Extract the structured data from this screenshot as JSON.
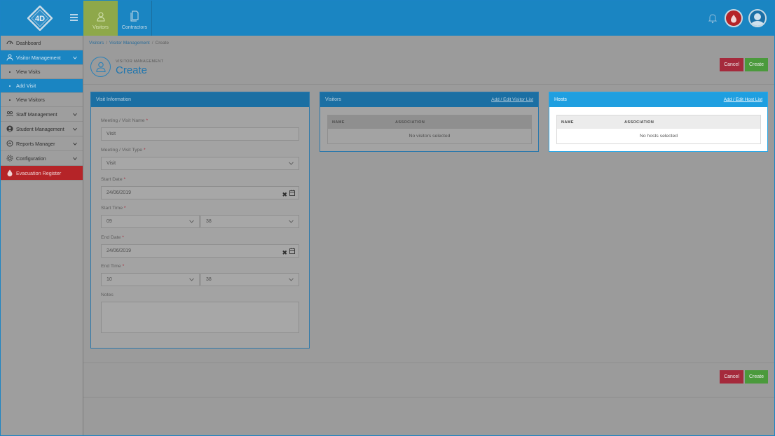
{
  "topbar": {
    "nav": [
      {
        "label": "Visitors"
      },
      {
        "label": "Contractors"
      }
    ]
  },
  "sidebar": {
    "items": [
      {
        "label": "Dashboard"
      },
      {
        "label": "Visitor Management"
      },
      {
        "label": "View Visits"
      },
      {
        "label": "Add Visit"
      },
      {
        "label": "View Visitors"
      },
      {
        "label": "Staff Management"
      },
      {
        "label": "Student Management"
      },
      {
        "label": "Reports Manager"
      },
      {
        "label": "Configuration"
      },
      {
        "label": "Evacuation Register"
      }
    ]
  },
  "breadcrumb": {
    "items": [
      "Visitors",
      "Visitor Management",
      "Create"
    ]
  },
  "page": {
    "subtitle": "VISITOR MANAGEMENT",
    "title": "Create"
  },
  "actions": {
    "cancel_label": "Cancel",
    "create_label": "Create"
  },
  "visit_info": {
    "heading": "Visit Information",
    "name_label": "Meeting / Visit Name",
    "name_value": "Visit",
    "type_label": "Meeting / Visit Type",
    "type_value": "Visit",
    "start_date_label": "Start Date",
    "start_date_value": "24/06/2019",
    "start_time_label": "Start Time",
    "start_hour": "09",
    "start_minute": "38",
    "end_date_label": "End Date",
    "end_date_value": "24/06/2019",
    "end_time_label": "End Time",
    "end_hour": "10",
    "end_minute": "38",
    "notes_label": "Notes",
    "required_mark": "*"
  },
  "visitors": {
    "heading": "Visitors",
    "link": "Add / Edit Visitor List",
    "col_name": "NAME",
    "col_association": "ASSOCIATION",
    "empty": "No visitors selected"
  },
  "hosts": {
    "heading": "Hosts",
    "link": "Add / Edit Host List",
    "col_name": "NAME",
    "col_association": "ASSOCIATION",
    "empty": "No hosts selected"
  },
  "icons": {
    "clear": "✖"
  },
  "colors": {
    "primary": "#1a85c2",
    "active_nav": "#8ea84a",
    "danger": "#b52428",
    "success": "#4b9a3c",
    "hosts_header": "#1f9fe0"
  }
}
